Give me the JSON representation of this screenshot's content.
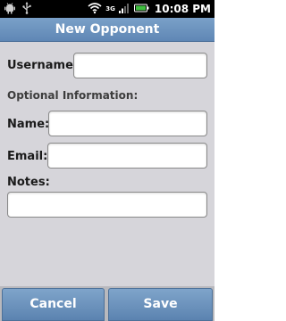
{
  "status_bar": {
    "network_label": "3G",
    "time": "10:08 PM"
  },
  "icons": {
    "android": "android-icon",
    "usb": "usb-icon",
    "wifi": "wifi-icon",
    "signal": "signal-icon",
    "battery": "battery-icon"
  },
  "title_bar": {
    "title": "New Opponent"
  },
  "form": {
    "username_label": "Username:",
    "username_value": "",
    "optional_section_label": "Optional Information:",
    "name_label": "Name:",
    "name_value": "",
    "email_label": "Email:",
    "email_value": "",
    "notes_label": "Notes:",
    "notes_value": ""
  },
  "buttons": {
    "cancel_label": "Cancel",
    "save_label": "Save"
  },
  "colors": {
    "accent": "#6a91bd",
    "background": "#d6d5da"
  }
}
